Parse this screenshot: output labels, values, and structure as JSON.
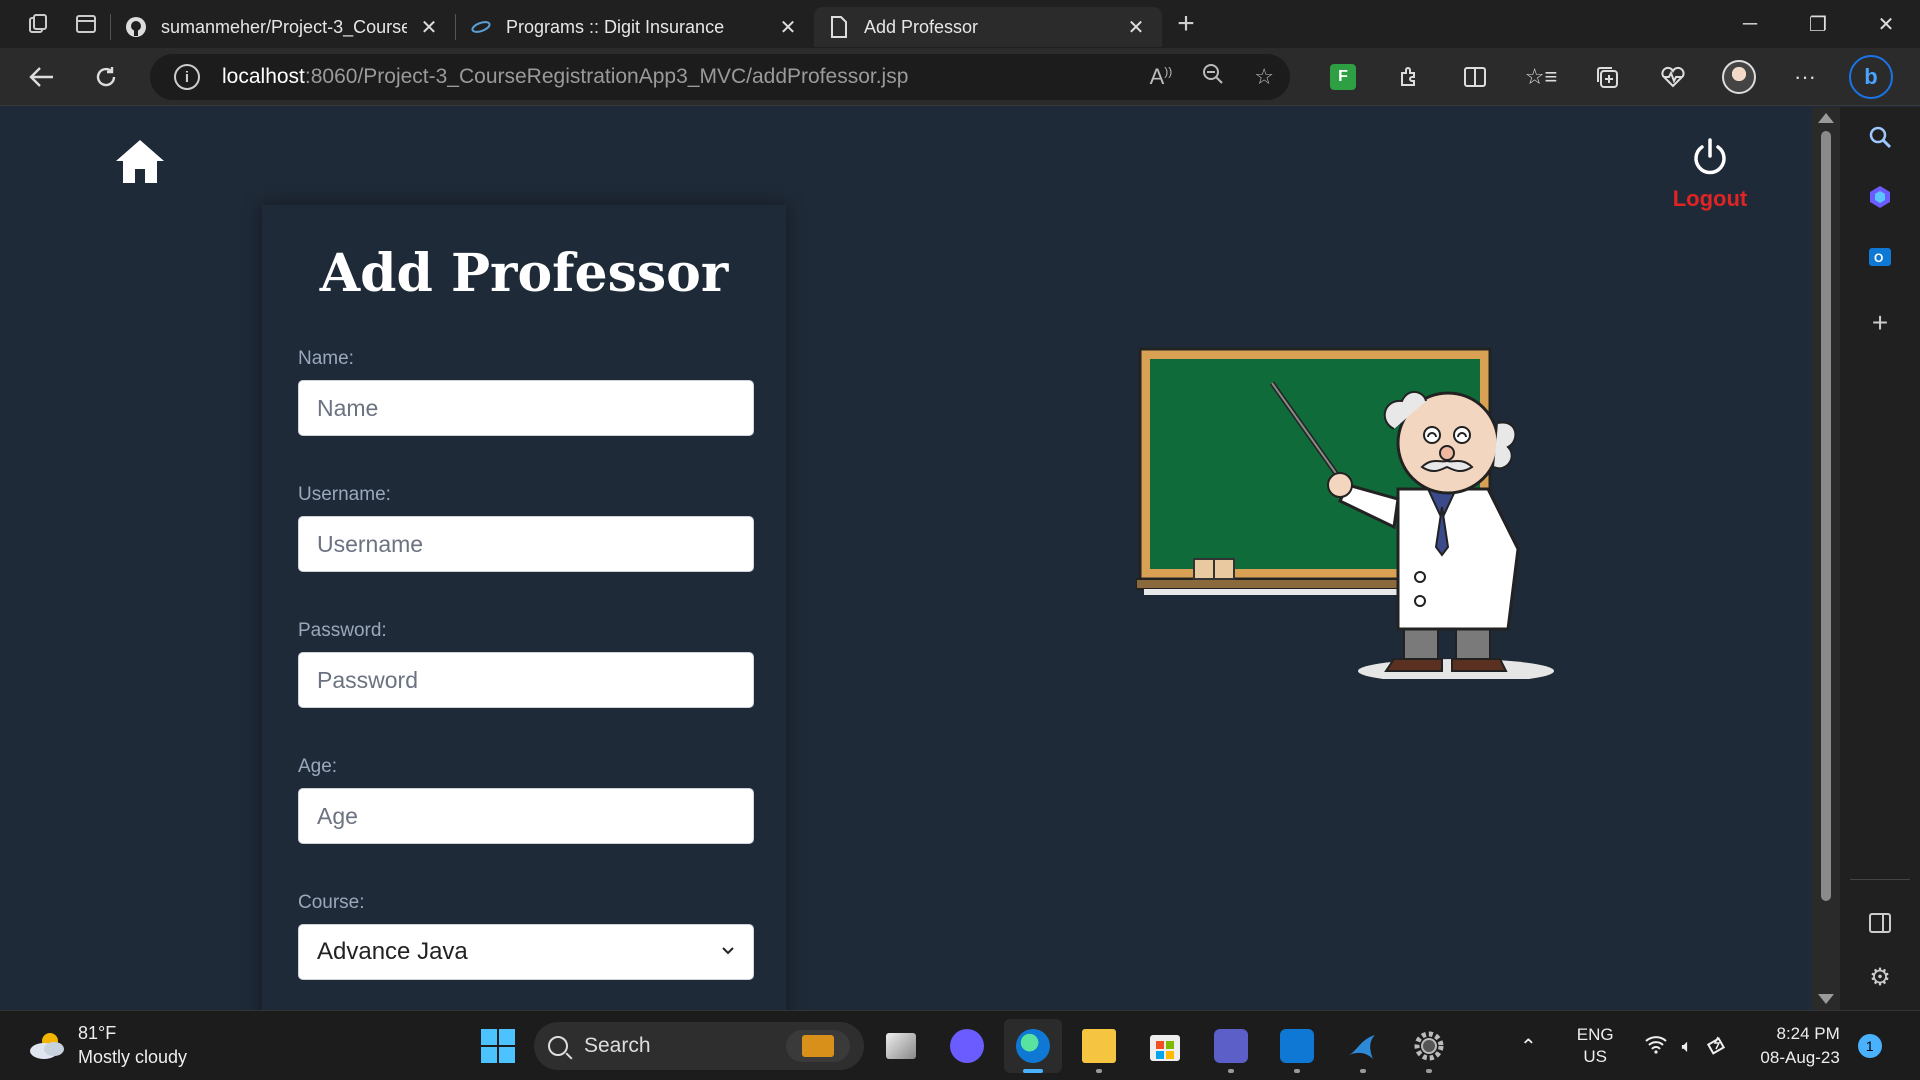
{
  "tabs": [
    {
      "title": "sumanmeher/Project-3_CourseRe",
      "icon": "github-icon"
    },
    {
      "title": "Programs :: Digit Insurance",
      "icon": "digit-icon"
    },
    {
      "title": "Add Professor",
      "icon": "page-icon"
    }
  ],
  "address": {
    "host": "localhost",
    "path": ":8060/Project-3_CourseRegistrationApp3_MVC/addProfessor.jsp"
  },
  "page": {
    "logout_label": "Logout",
    "form": {
      "title": "Add Professor",
      "fields": [
        {
          "label": "Name:",
          "placeholder": "Name"
        },
        {
          "label": "Username:",
          "placeholder": "Username"
        },
        {
          "label": "Password:",
          "placeholder": "Password"
        },
        {
          "label": "Age:",
          "placeholder": "Age"
        },
        {
          "label": "Course:",
          "value": "Advance Java"
        }
      ]
    }
  },
  "taskbar": {
    "weather_temp": "81°F",
    "weather_desc": "Mostly cloudy",
    "search_label": "Search",
    "lang_top": "ENG",
    "lang_bottom": "US",
    "time": "8:24 PM",
    "date": "08-Aug-23",
    "notification_count": "1"
  },
  "colors": {
    "page_bg": "#1f2a38",
    "logout_red": "#e02424",
    "chalkboard": "#0f6b3a"
  }
}
